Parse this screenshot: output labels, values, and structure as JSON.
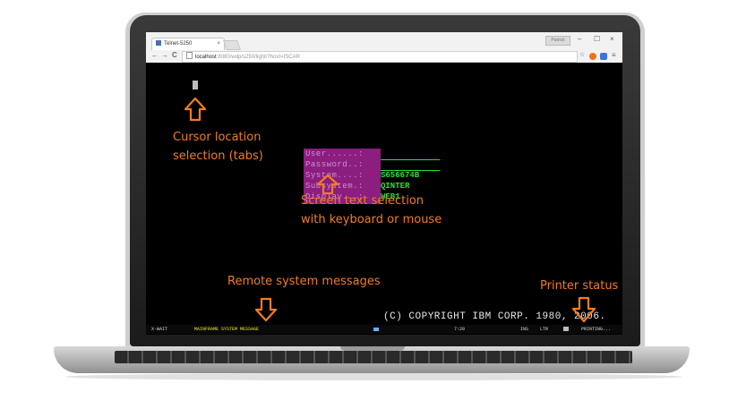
{
  "browser": {
    "tab_title": "Telnet-5250",
    "tab_close": "×",
    "profile": "Patrick",
    "win_min": "–",
    "win_max": "☐",
    "win_close": "×",
    "nav_back": "←",
    "nav_forward": "→",
    "nav_reload": "C",
    "url_host": "localhost",
    "url_rest": ":8080/wdp/s250/light/?host=ISCAR",
    "star": "☆",
    "menu": "≡"
  },
  "terminal": {
    "fields": [
      {
        "label": "User......:",
        "value": ""
      },
      {
        "label": "Password..:",
        "value": ""
      },
      {
        "label": "System....:",
        "value": "S656674B"
      },
      {
        "label": "Subsystem.:",
        "value": "QINTER"
      },
      {
        "label": "Display...:",
        "value": "WEB1"
      }
    ],
    "copyright": "(C) COPYRIGHT IBM CORP. 1980, 2006."
  },
  "status_bar": {
    "state": "X-WAIT",
    "message": "MAINFRAME SYSTEM MESSAGE",
    "position": "7:20",
    "ins": "INS",
    "ltr": "LTR",
    "printing": "PRINTING..."
  },
  "annotations": {
    "cursor_line1": "Cursor location",
    "cursor_line2": "selection (tabs)",
    "text_line1": "Screen text selection",
    "text_line2": "with keyboard or mouse",
    "remote": "Remote system messages",
    "printer": "Printer status"
  },
  "colors": {
    "annotation": "#f07d21",
    "field_highlight": "#8b1e7f",
    "field_value": "#22e33a",
    "status_message": "#e8e23a"
  }
}
